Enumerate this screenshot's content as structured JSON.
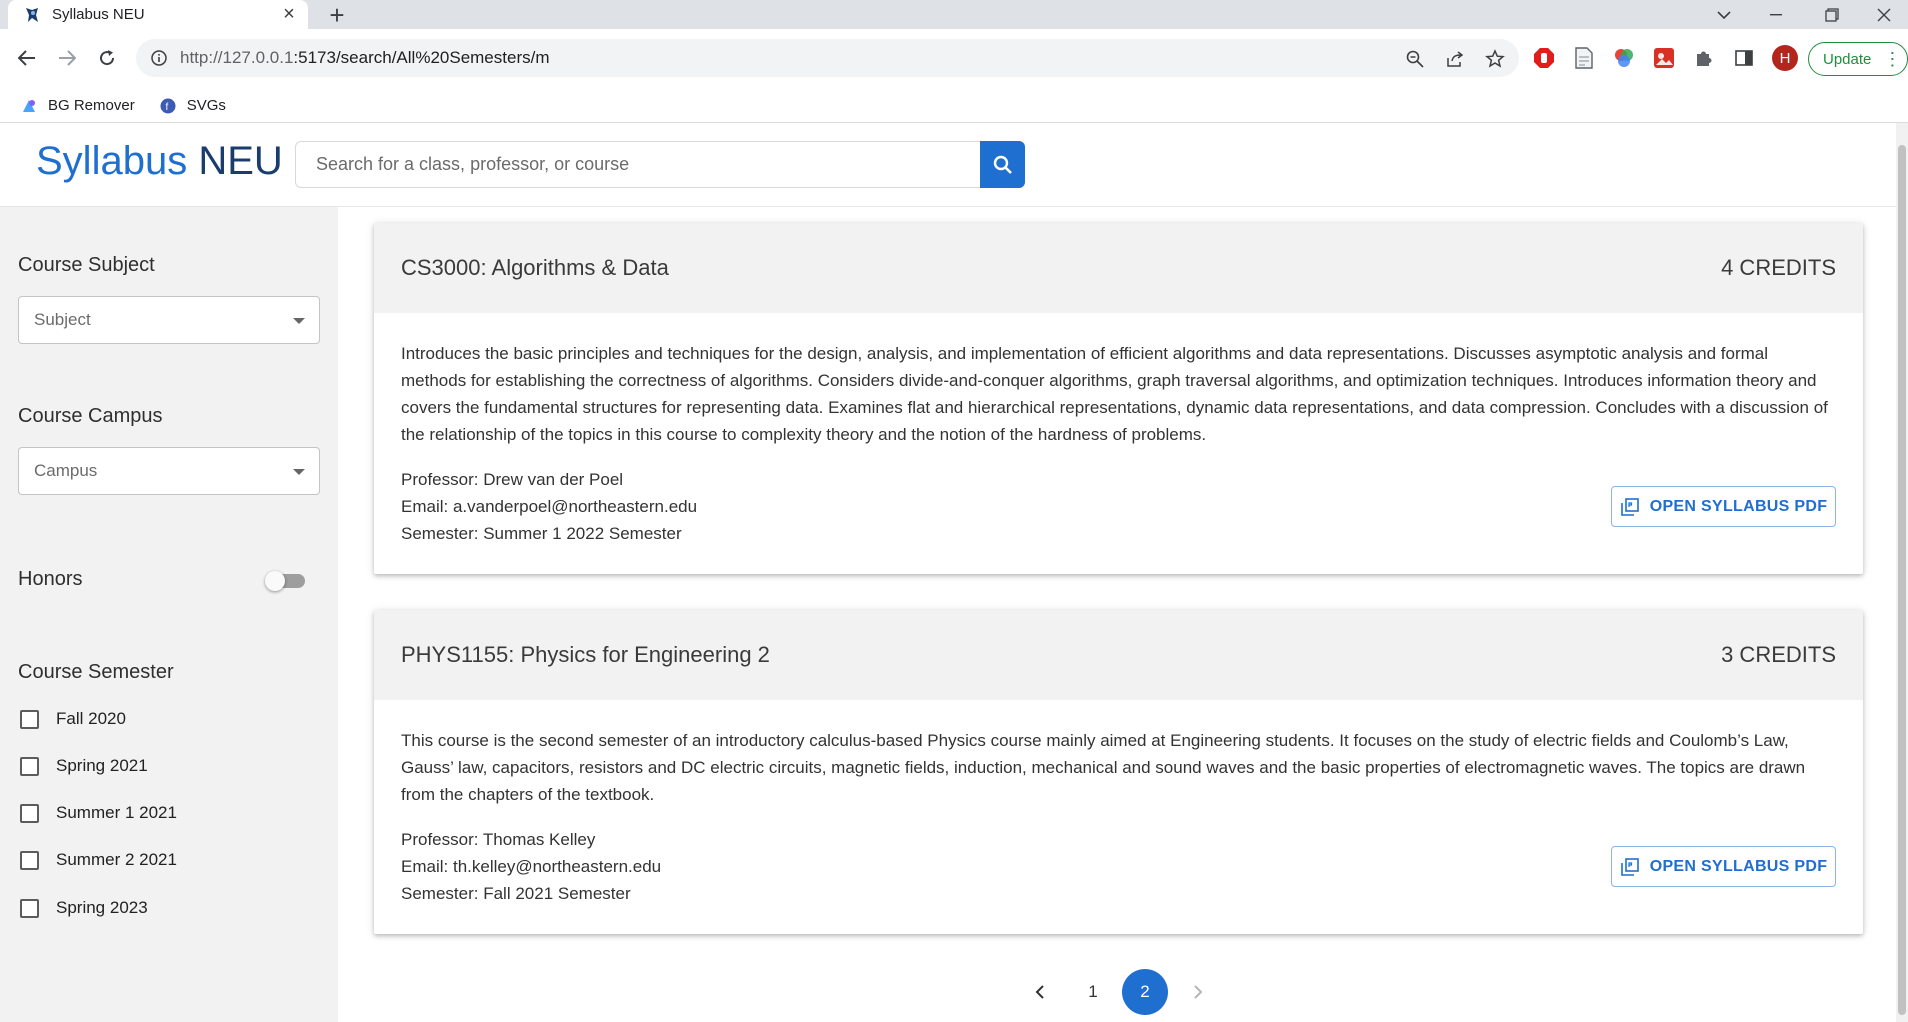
{
  "browser": {
    "tab_title": "Syllabus NEU",
    "url_host": "http://127.0.0.1",
    "url_path": ":5173/search/All%20Semesters/m",
    "profile_initial": "H",
    "update_label": "Update",
    "bookmarks": [
      {
        "label": "BG Remover",
        "icon": "bg-remover-icon"
      },
      {
        "label": "SVGs",
        "icon": "svgs-icon"
      }
    ]
  },
  "app": {
    "brand_part1": "Syllabus",
    "brand_part2": "NEU",
    "search_placeholder": "Search for a class, professor, or course",
    "accent_color": "#1f6fd1"
  },
  "sidebar": {
    "subject_heading": "Course Subject",
    "subject_placeholder": "Subject",
    "campus_heading": "Course Campus",
    "campus_placeholder": "Campus",
    "honors_label": "Honors",
    "honors_on": false,
    "semester_heading": "Course Semester",
    "semesters": [
      {
        "label": "Fall 2020",
        "checked": false
      },
      {
        "label": "Spring 2021",
        "checked": false
      },
      {
        "label": "Summer 1 2021",
        "checked": false
      },
      {
        "label": "Summer 2 2021",
        "checked": false
      },
      {
        "label": "Spring 2023",
        "checked": false
      }
    ]
  },
  "courses": [
    {
      "title": "CS3000: Algorithms & Data",
      "credits": "4 CREDITS",
      "description": "Introduces the basic principles and techniques for the design, analysis, and implementation of efficient algorithms and data representations. Discusses asymptotic analysis and formal methods for establishing the correctness of algorithms. Considers divide-and-conquer algorithms, graph traversal algorithms, and optimization techniques. Introduces information theory and covers the fundamental structures for representing data. Examines flat and hierarchical representations, dynamic data representations, and data compression. Concludes with a discussion of the relationship of the topics in this course to complexity theory and the notion of the hardness of problems.",
      "professor_label": "Professor:",
      "professor": "Drew van der Poel",
      "email_label": "Email:",
      "email": "a.vanderpoel@northeastern.edu",
      "semester_label": "Semester:",
      "semester": "Summer 1 2022 Semester",
      "button_label": "OPEN SYLLABUS PDF"
    },
    {
      "title": "PHYS1155: Physics for Engineering 2",
      "credits": "3 CREDITS",
      "description": "This course is the second semester of an introductory calculus-based Physics course mainly aimed at Engineering students. It focuses on the study of electric fields and Coulomb’s Law, Gauss’ law, capacitors, resistors and DC electric circuits, magnetic fields, induction, mechanical and sound waves and the basic properties of electromagnetic waves. The topics are drawn from the chapters of the textbook.",
      "professor_label": "Professor:",
      "professor": "Thomas Kelley",
      "email_label": "Email:",
      "email": "th.kelley@northeastern.edu",
      "semester_label": "Semester:",
      "semester": "Fall 2021 Semester",
      "button_label": "OPEN SYLLABUS PDF"
    }
  ],
  "pagination": {
    "pages": [
      "1",
      "2"
    ],
    "current": "2"
  }
}
